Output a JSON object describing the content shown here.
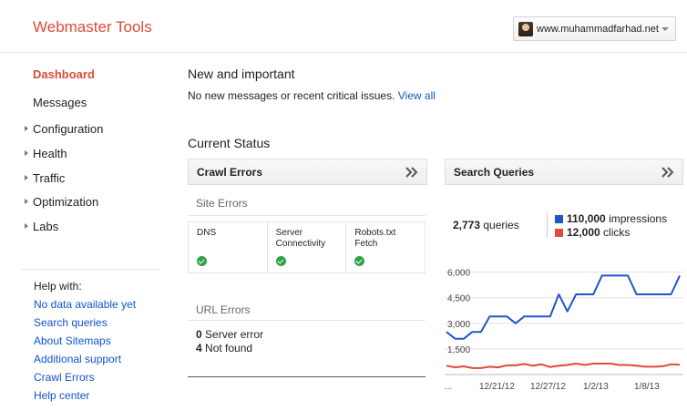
{
  "app": {
    "title": "Webmaster Tools"
  },
  "site_selector": {
    "value": "www.muhammadfarhad.net"
  },
  "nav": {
    "items": [
      {
        "label": "Dashboard",
        "active": true,
        "expandable": false
      },
      {
        "label": "Messages",
        "active": false,
        "expandable": false
      },
      {
        "label": "Configuration",
        "active": false,
        "expandable": true
      },
      {
        "label": "Health",
        "active": false,
        "expandable": true
      },
      {
        "label": "Traffic",
        "active": false,
        "expandable": true
      },
      {
        "label": "Optimization",
        "active": false,
        "expandable": true
      },
      {
        "label": "Labs",
        "active": false,
        "expandable": true
      }
    ]
  },
  "help": {
    "title": "Help with:",
    "links": [
      "No data available yet",
      "Search queries",
      "About Sitemaps",
      "Additional support",
      "Crawl Errors",
      "Help center"
    ]
  },
  "new_important": {
    "title": "New and important",
    "message": "No new messages or recent critical issues.",
    "view_all": "View all"
  },
  "current_status": {
    "title": "Current Status"
  },
  "crawl_errors": {
    "title": "Crawl Errors",
    "site_errors": {
      "title": "Site Errors",
      "cells": [
        {
          "line1": "DNS",
          "line2": "",
          "status": "ok"
        },
        {
          "line1": "Server",
          "line2": "Connectivity",
          "status": "ok"
        },
        {
          "line1": "Robots.txt",
          "line2": "Fetch",
          "status": "ok"
        }
      ]
    },
    "url_errors": {
      "title": "URL Errors",
      "rows": [
        {
          "count": "0",
          "label": "Server error"
        },
        {
          "count": "4",
          "label": "Not found"
        }
      ]
    }
  },
  "search_queries": {
    "title": "Search Queries",
    "queries_count": "2,773",
    "queries_label": "queries",
    "impressions_count": "110,000",
    "impressions_label": "impressions",
    "clicks_count": "12,000",
    "clicks_label": "clicks"
  },
  "colors": {
    "accent": "#dd4b39",
    "link": "#1155cc",
    "impressions": "#2255cc",
    "clicks": "#dd4b39",
    "ok": "#2da444"
  },
  "chart_data": {
    "type": "line",
    "x_tick_labels": [
      "...",
      "12/21/12",
      "12/27/12",
      "1/2/13",
      "1/8/13"
    ],
    "y_tick_labels": [
      "6,000",
      "4,500",
      "3,000",
      "1,500"
    ],
    "ylim": [
      0,
      6300
    ],
    "series": [
      {
        "name": "impressions",
        "color": "#2255cc",
        "values": [
          2500,
          2100,
          2100,
          2500,
          2500,
          3400,
          3400,
          3400,
          3000,
          3400,
          3400,
          3400,
          3400,
          4700,
          3700,
          4700,
          4700,
          4700,
          5800,
          5800,
          5800,
          5800,
          4700,
          4700,
          4700,
          4700,
          4700,
          5800
        ]
      },
      {
        "name": "clicks",
        "color": "#dd4b39",
        "values": [
          520,
          420,
          480,
          380,
          380,
          460,
          420,
          540,
          540,
          620,
          520,
          600,
          440,
          520,
          560,
          640,
          560,
          640,
          640,
          640,
          560,
          560,
          520,
          460,
          460,
          480,
          600,
          580
        ]
      }
    ]
  }
}
